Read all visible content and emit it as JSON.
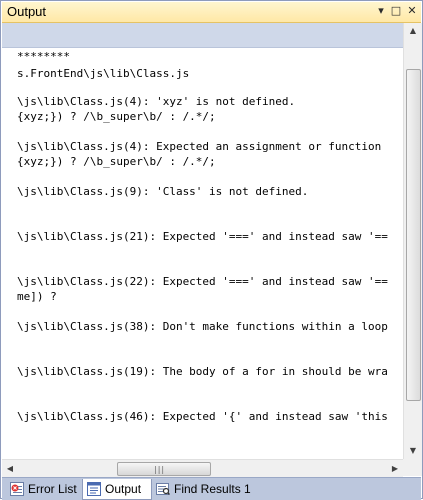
{
  "window": {
    "title": "Output",
    "buttons": {
      "dropdown": "▾",
      "maximize": "□",
      "close": "✕"
    }
  },
  "output": {
    "lines": [
      "********",
      "s.FrontEnd\\js\\lib\\Class.js",
      "",
      "\\js\\lib\\Class.js(4): 'xyz' is not defined.",
      "{xyz;}) ? /\\b_super\\b/ : /.*/;",
      "",
      "\\js\\lib\\Class.js(4): Expected an assignment or function",
      "{xyz;}) ? /\\b_super\\b/ : /.*/;",
      "",
      "\\js\\lib\\Class.js(9): 'Class' is not defined.",
      "",
      "",
      "\\js\\lib\\Class.js(21): Expected '===' and instead saw '==",
      "",
      "",
      "\\js\\lib\\Class.js(22): Expected '===' and instead saw '==",
      "me]) ?",
      "",
      "\\js\\lib\\Class.js(38): Don't make functions within a loop",
      "",
      "",
      "\\js\\lib\\Class.js(19): The body of a for in should be wra",
      "",
      "",
      "\\js\\lib\\Class.js(46): Expected '{' and instead saw 'this"
    ]
  },
  "tabs": [
    {
      "label": "Error List",
      "icon": "error-list-icon",
      "active": false
    },
    {
      "label": "Output",
      "icon": "output-icon",
      "active": true
    },
    {
      "label": "Find Results 1",
      "icon": "find-results-icon",
      "active": false
    }
  ],
  "colors": {
    "title_bg": "#ffe8a6",
    "toolbar_bg": "#cfd8e9",
    "tabbar_bg": "#bcc7dd",
    "frame_border": "#8e9bbc"
  }
}
